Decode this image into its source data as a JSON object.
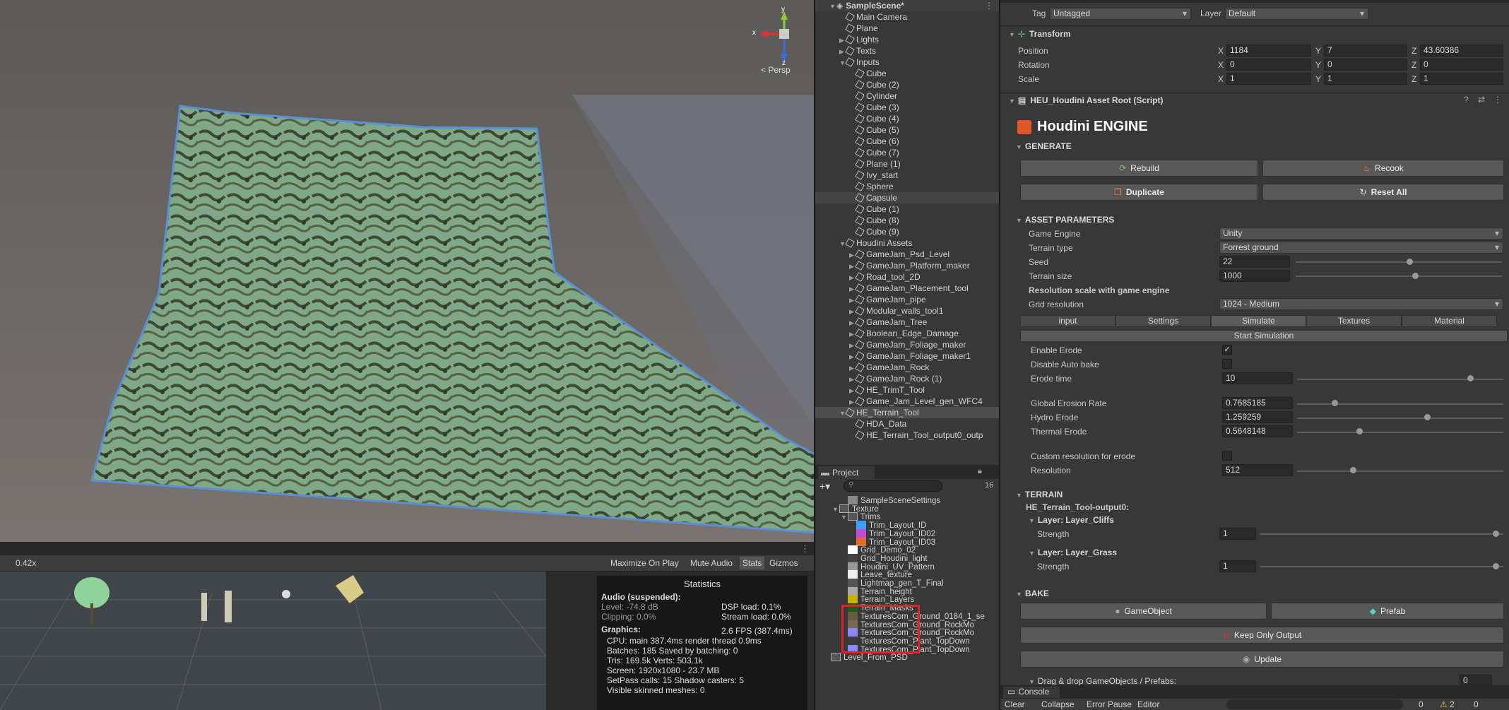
{
  "scene": {
    "persp_label": "< Persp",
    "axis_x": "x",
    "axis_y": "y",
    "axis_z": "z"
  },
  "gamebar": {
    "scale": "0.42x",
    "maximize": "Maximize On Play",
    "mute": "Mute Audio",
    "stats": "Stats",
    "gizmos": "Gizmos"
  },
  "stats": {
    "title": "Statistics",
    "audio_head": "Audio (suspended):",
    "level": "Level: -74.8 dB",
    "clipping": "Clipping: 0.0%",
    "dsp": "DSP load: 0.1%",
    "stream": "Stream load: 0.0%",
    "graphics_head": "Graphics:",
    "fps": "2.6 FPS (387.4ms)",
    "cpu": "CPU: main 387.4ms  render thread 0.9ms",
    "batches": "Batches: 185   Saved by batching: 0",
    "tris": "Tris: 169.5k    Verts: 503.1k",
    "screen": "Screen: 1920x1080 - 23.7 MB",
    "setpass": "SetPass calls: 15       Shadow casters: 5",
    "skinned": "Visible skinned meshes: 0"
  },
  "hierarchy": {
    "scene_name": "SampleScene*",
    "items": [
      {
        "label": "Main Camera",
        "indent": 1,
        "arrow": ""
      },
      {
        "label": "Plane",
        "indent": 1,
        "arrow": ""
      },
      {
        "label": "Lights",
        "indent": 1,
        "arrow": "▶"
      },
      {
        "label": "Texts",
        "indent": 1,
        "arrow": "▶"
      },
      {
        "label": "Inputs",
        "indent": 1,
        "arrow": "▼"
      },
      {
        "label": "Cube",
        "indent": 2,
        "arrow": ""
      },
      {
        "label": "Cube (2)",
        "indent": 2,
        "arrow": ""
      },
      {
        "label": "Cylinder",
        "indent": 2,
        "arrow": ""
      },
      {
        "label": "Cube (3)",
        "indent": 2,
        "arrow": ""
      },
      {
        "label": "Cube (4)",
        "indent": 2,
        "arrow": ""
      },
      {
        "label": "Cube (5)",
        "indent": 2,
        "arrow": ""
      },
      {
        "label": "Cube (6)",
        "indent": 2,
        "arrow": ""
      },
      {
        "label": "Cube (7)",
        "indent": 2,
        "arrow": ""
      },
      {
        "label": "Plane (1)",
        "indent": 2,
        "arrow": ""
      },
      {
        "label": "Ivy_start",
        "indent": 2,
        "arrow": ""
      },
      {
        "label": "Sphere",
        "indent": 2,
        "arrow": ""
      },
      {
        "label": "Capsule",
        "indent": 2,
        "arrow": "",
        "hl": true
      },
      {
        "label": "Cube (1)",
        "indent": 2,
        "arrow": ""
      },
      {
        "label": "Cube (8)",
        "indent": 2,
        "arrow": ""
      },
      {
        "label": "Cube (9)",
        "indent": 2,
        "arrow": ""
      },
      {
        "label": "Houdini Assets",
        "indent": 1,
        "arrow": "▼"
      },
      {
        "label": "GameJam_Psd_Level",
        "indent": 2,
        "arrow": "▶"
      },
      {
        "label": "GameJam_Platform_maker",
        "indent": 2,
        "arrow": "▶"
      },
      {
        "label": "Road_tool_2D",
        "indent": 2,
        "arrow": "▶"
      },
      {
        "label": "GameJam_Placement_tool",
        "indent": 2,
        "arrow": "▶"
      },
      {
        "label": "GameJam_pipe",
        "indent": 2,
        "arrow": "▶"
      },
      {
        "label": "Modular_walls_tool1",
        "indent": 2,
        "arrow": "▶"
      },
      {
        "label": "GameJam_Tree",
        "indent": 2,
        "arrow": "▶"
      },
      {
        "label": "Boolean_Edge_Damage",
        "indent": 2,
        "arrow": "▶"
      },
      {
        "label": "GameJam_Foliage_maker",
        "indent": 2,
        "arrow": "▶"
      },
      {
        "label": "GameJam_Foliage_maker1",
        "indent": 2,
        "arrow": "▶"
      },
      {
        "label": "GameJam_Rock",
        "indent": 2,
        "arrow": "▶"
      },
      {
        "label": "GameJam_Rock (1)",
        "indent": 2,
        "arrow": "▶"
      },
      {
        "label": "HE_TrimT_Tool",
        "indent": 2,
        "arrow": "▶"
      },
      {
        "label": "Game_Jam_Level_gen_WFC4",
        "indent": 2,
        "arrow": "▶"
      },
      {
        "label": "HE_Terrain_Tool",
        "indent": 1,
        "arrow": "▼",
        "sel": true
      },
      {
        "label": "HDA_Data",
        "indent": 2,
        "arrow": ""
      },
      {
        "label": "HE_Terrain_Tool_output0_outp",
        "indent": 2,
        "arrow": ""
      }
    ]
  },
  "project": {
    "title": "Project",
    "count": "16",
    "items": [
      {
        "label": "SampleSceneSettings",
        "indent": 3,
        "color": "#888"
      },
      {
        "label": "Texture",
        "indent": 2,
        "color": "folder",
        "arrow": "▼"
      },
      {
        "label": "Trims",
        "indent": 3,
        "color": "folder",
        "arrow": "▼"
      },
      {
        "label": "Trim_Layout_ID",
        "indent": 4,
        "color": "#3aa0ff"
      },
      {
        "label": "Trim_Layout_ID02",
        "indent": 4,
        "color": "#c04bd6"
      },
      {
        "label": "Trim_Layout_ID03",
        "indent": 4,
        "color": "#e26a2c"
      },
      {
        "label": "Grid_Demo_02",
        "indent": 3,
        "color": "#ffffff"
      },
      {
        "label": "Grid_Houdini_light",
        "indent": 3,
        "color": "#444"
      },
      {
        "label": "Houdini_UV_Pattern",
        "indent": 3,
        "color": "#999"
      },
      {
        "label": "Leave_texture",
        "indent": 3,
        "color": "#eee"
      },
      {
        "label": "Lightmap_gen_T_Final",
        "indent": 3,
        "color": "#555"
      },
      {
        "label": "Terrain_height",
        "indent": 3,
        "color": "#aaa"
      },
      {
        "label": "Terrain_Layers",
        "indent": 3,
        "color": "#c8b400"
      },
      {
        "label": "Terrain_Masks",
        "indent": 3,
        "color": "#1e5a1e"
      },
      {
        "label": "TexturesCom_Ground_0184_1_se",
        "indent": 3,
        "color": "#6a5a40"
      },
      {
        "label": "TexturesCom_Ground_RockMo",
        "indent": 3,
        "color": "#7a6a55"
      },
      {
        "label": "TexturesCom_Ground_RockMo",
        "indent": 3,
        "color": "#8a88ff"
      },
      {
        "label": "TexturesCom_Plant_TopDown",
        "indent": 3,
        "color": "#3a3a3a"
      },
      {
        "label": "TexturesCom_Plant_TopDown",
        "indent": 3,
        "color": "#8a88ff"
      },
      {
        "label": "Level_From_PSD",
        "indent": 1,
        "color": "folder"
      }
    ]
  },
  "inspector": {
    "tag_label": "Tag",
    "tag_value": "Untagged",
    "layer_label": "Layer",
    "layer_value": "Default",
    "transform_title": "Transform",
    "position": {
      "label": "Position",
      "x": "1184",
      "y": "7",
      "z": "43.60386"
    },
    "rotation": {
      "label": "Rotation",
      "x": "0",
      "y": "0",
      "z": "0"
    },
    "scale": {
      "label": "Scale",
      "x": "1",
      "y": "1",
      "z": "1"
    },
    "script_title": "HEU_Houdini Asset Root (Script)",
    "engine_title": "Houdini ENGINE",
    "generate": "GENERATE",
    "rebuild": "Rebuild",
    "recook": "Recook",
    "duplicate": "Duplicate",
    "reset_all": "Reset All",
    "asset_params": "ASSET PARAMETERS",
    "game_engine_label": "Game Engine",
    "game_engine_value": "Unity",
    "terrain_type_label": "Terrain type",
    "terrain_type_value": "Forrest ground",
    "seed_label": "Seed",
    "seed_value": "22",
    "seed_level": 0.55,
    "terrain_size_label": "Terrain size",
    "terrain_size_value": "1000",
    "terrain_size_level": 0.58,
    "res_scale_label": "Resolution scale with game engine",
    "grid_res_label": "Grid resolution",
    "grid_res_value": "1024 - Medium",
    "tabs": [
      "input",
      "Settings",
      "Simulate",
      "Textures",
      "Material"
    ],
    "start_sim": "Start Simulation",
    "enable_erode": "Enable Erode",
    "disable_auto_bake": "Disable Auto bake",
    "erode_time_label": "Erode time",
    "erode_time_value": "10",
    "erode_time_level": 0.84,
    "global_erosion_label": "Global Erosion Rate",
    "global_erosion_value": "0.7685185",
    "global_erosion_level": 0.18,
    "hydro_label": "Hydro Erode",
    "hydro_value": "1.259259",
    "hydro_level": 0.63,
    "thermal_label": "Thermal Erode",
    "thermal_value": "0.5648148",
    "thermal_level": 0.3,
    "custom_res_label": "Custom resolution for erode",
    "resolution_label": "Resolution",
    "resolution_value": "512",
    "resolution_level": 0.27,
    "terrain": "TERRAIN",
    "output_label": "HE_Terrain_Tool-output0:",
    "layer_cliffs": "Layer: Layer_Cliffs",
    "layer_grass": "Layer: Layer_Grass",
    "strength_label": "Strength",
    "strength_value": "1",
    "bake": "BAKE",
    "gameobject_btn": "GameObject",
    "prefab_btn": "Prefab",
    "keep_only_output": "Keep Only Output",
    "update": "Update",
    "drag_drop": "Drag & drop GameObjects / Prefabs:",
    "drag_count": "0",
    "console_title": "Console",
    "console_clear": "Clear",
    "console_collapse": "Collapse",
    "console_error_pause": "Error Pause",
    "console_editor": "Editor",
    "console_counts": [
      "0",
      "2",
      "0"
    ]
  }
}
